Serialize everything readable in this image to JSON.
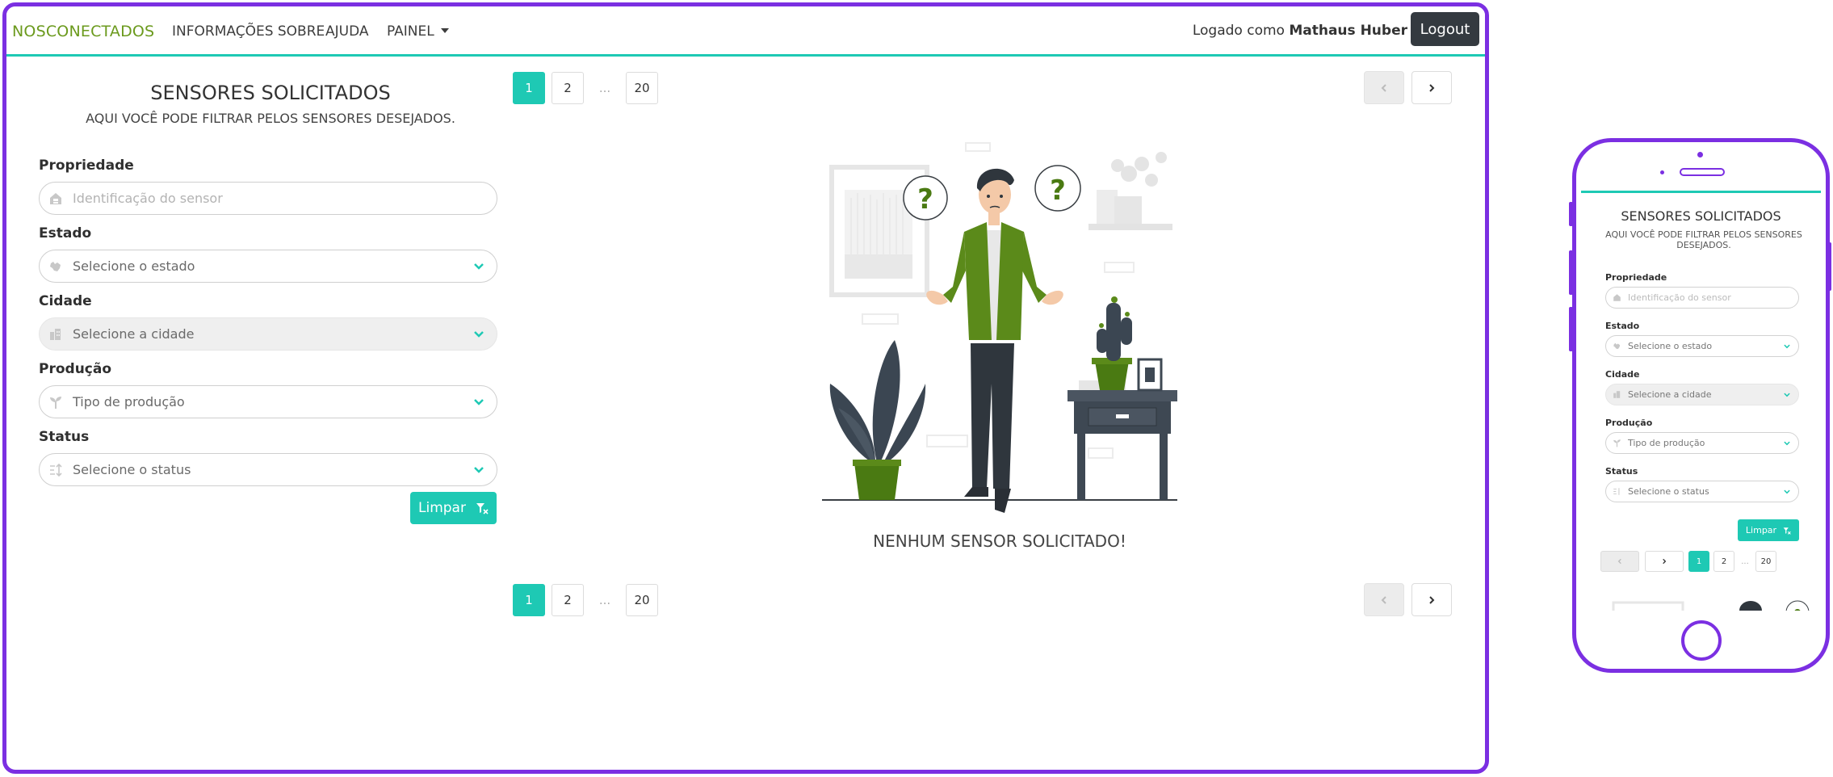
{
  "nav": {
    "brand": "NOSCONECTADOS",
    "links": [
      "INFORMAÇÕES SOBRE",
      "AJUDA",
      "PAINEL"
    ],
    "logged_prefix": "Logado como ",
    "user": "Mathaus Huber",
    "logout": "Logout"
  },
  "filters": {
    "title": "SENSORES SOLICITADOS",
    "subtitle": "AQUI VOCÊ PODE FILTRAR PELOS SENSORES DESEJADOS.",
    "fields": [
      {
        "label": "Propriedade",
        "placeholder": "Identificação do sensor",
        "icon": "property-icon"
      },
      {
        "label": "Estado",
        "placeholder": "Selecione o estado",
        "icon": "map-icon"
      },
      {
        "label": "Cidade",
        "placeholder": "Selecione a cidade",
        "icon": "city-icon"
      },
      {
        "label": "Produção",
        "placeholder": "Tipo de produção",
        "icon": "sprout-icon"
      },
      {
        "label": "Status",
        "placeholder": "Selecione o status",
        "icon": "sort-icon"
      }
    ],
    "clear": "Limpar"
  },
  "pagination": {
    "pages": [
      "1",
      "2",
      "...",
      "20"
    ],
    "current": "1"
  },
  "empty_message": "NENHUM SENSOR SOLICITADO!",
  "colors": {
    "accent": "#1ec9b4",
    "frame": "#7b2fe2",
    "brand": "#6b9a1d",
    "dark_button": "#343a40",
    "illustration_green": "#5b8a1a"
  }
}
